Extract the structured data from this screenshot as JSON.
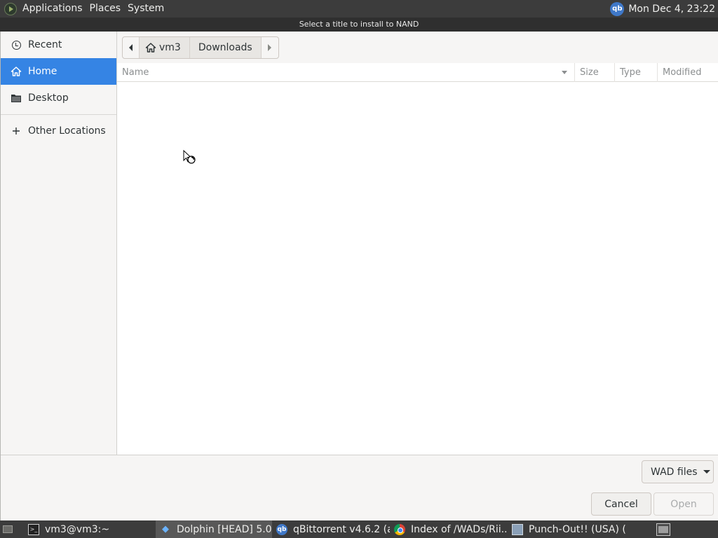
{
  "top_panel": {
    "menus": [
      "Applications",
      "Places",
      "System"
    ],
    "tray_icon": "qbittorrent-tray-icon",
    "tray_text": "qb",
    "clock": "Mon Dec  4, 23:22"
  },
  "dialog": {
    "title": "Select a title to install to NAND",
    "sidebar": {
      "items": [
        {
          "label": "Recent",
          "icon": "clock-icon",
          "selected": false
        },
        {
          "label": "Home",
          "icon": "home-icon",
          "selected": true
        },
        {
          "label": "Desktop",
          "icon": "folder-icon",
          "selected": false
        },
        {
          "label": "Other Locations",
          "icon": "plus-icon",
          "selected": false
        }
      ]
    },
    "pathbar": {
      "segments": [
        "vm3",
        "Downloads"
      ]
    },
    "columns": {
      "name": "Name",
      "size": "Size",
      "type": "Type",
      "modified": "Modified"
    },
    "filter": {
      "selected": "WAD files"
    },
    "buttons": {
      "cancel": "Cancel",
      "open": "Open"
    }
  },
  "taskbar": {
    "items": [
      {
        "label": "vm3@vm3:~",
        "icon": "terminal-icon",
        "active": false
      },
      {
        "label": "Dolphin [HEAD] 5.0...",
        "icon": "dolphin-icon",
        "active": true
      },
      {
        "label": "qBittorrent v4.6.2 (a...",
        "icon": "qbittorrent-icon",
        "active": false
      },
      {
        "label": "Index of /WADs/Rii...",
        "icon": "chrome-icon",
        "active": false
      },
      {
        "label": "Punch-Out!! (USA) (...",
        "icon": "app-window-icon",
        "active": false
      }
    ]
  },
  "colors": {
    "accent": "#3584e4",
    "panel": "#3c3c3c"
  }
}
